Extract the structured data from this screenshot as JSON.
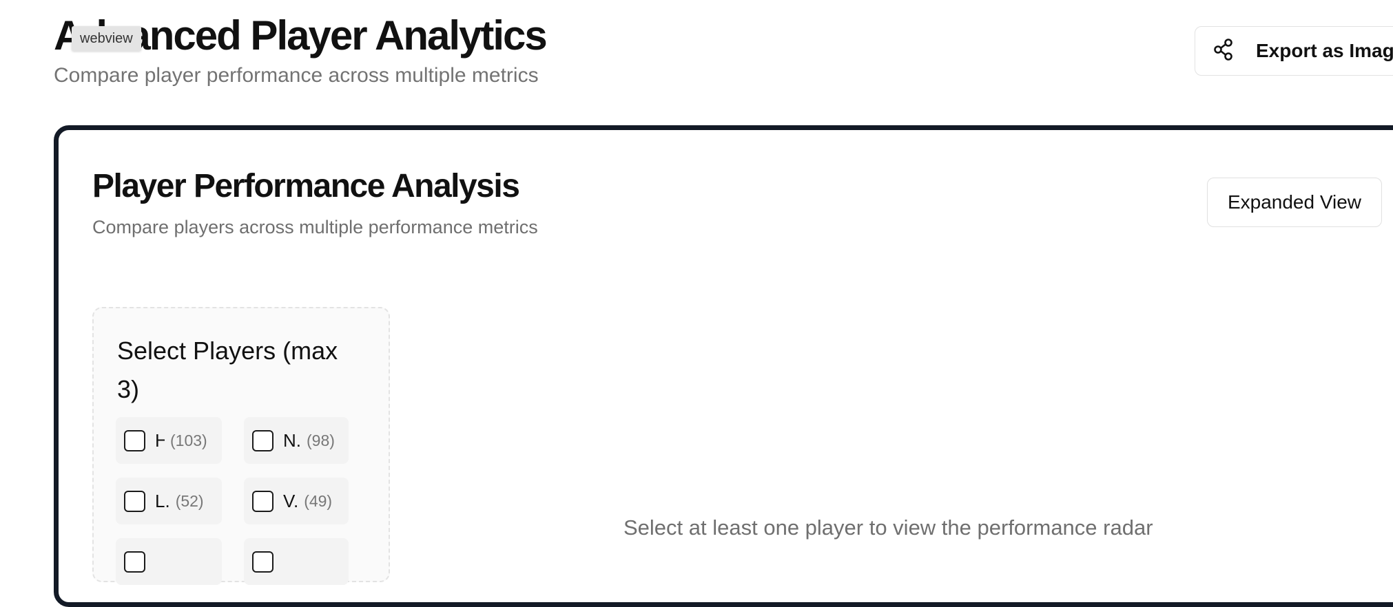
{
  "header": {
    "title": "Advanced Player Analytics",
    "webview_tag": "webview",
    "subtitle": "Compare player performance across multiple metrics",
    "export_label": "Export as Image"
  },
  "card": {
    "title": "Player Performance Analysis",
    "subtitle": "Compare players across multiple performance metrics",
    "expanded_view_label": "Expanded View"
  },
  "player_panel": {
    "heading": "Select Players (max 3)",
    "players": [
      {
        "name": "H.",
        "count": "(103)",
        "checked": false
      },
      {
        "name": "N.",
        "count": "(98)",
        "checked": false
      },
      {
        "name": "L.",
        "count": "(52)",
        "checked": false
      },
      {
        "name": "V.",
        "count": "(49)",
        "checked": false
      }
    ]
  },
  "chart_area": {
    "empty_message": "Select at least one player to view the performance radar"
  },
  "colors": {
    "card_border": "#131a26",
    "muted_text": "#737373",
    "panel_background": "#fafafa"
  },
  "icons": {
    "export": "share-icon",
    "checkbox": "checkbox-unchecked-icon"
  }
}
